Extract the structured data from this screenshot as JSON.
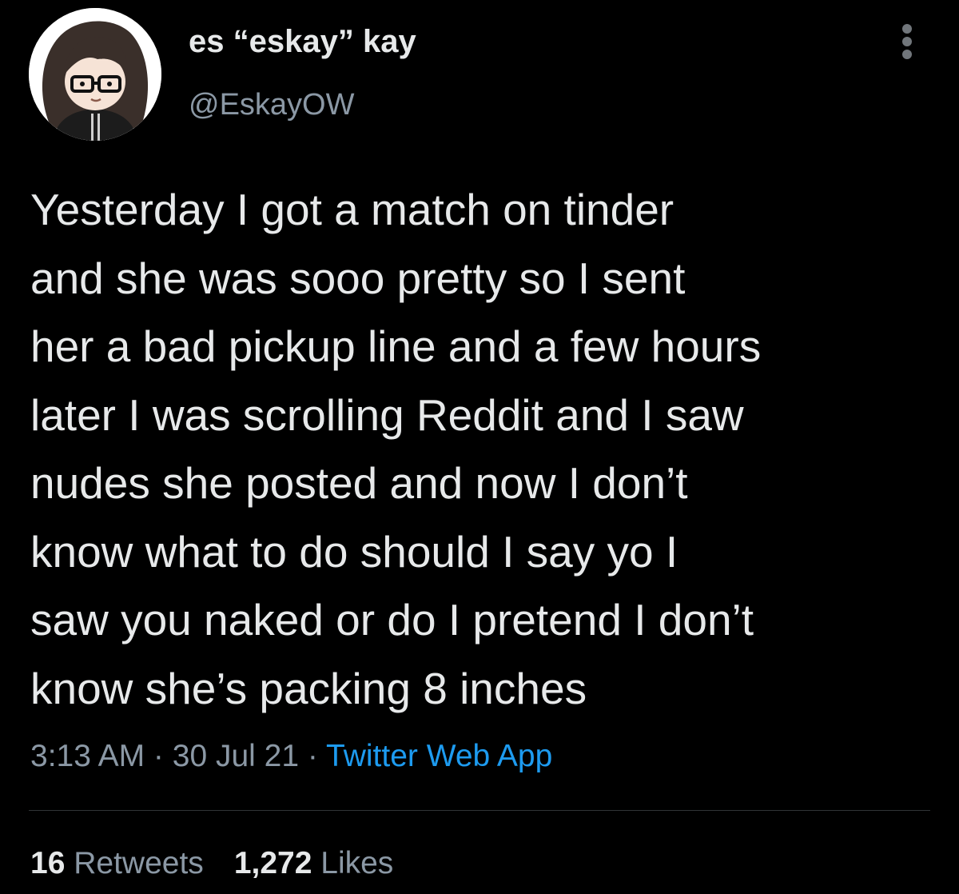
{
  "user": {
    "display_name": "es “eskay” kay",
    "handle": "@EskayOW",
    "avatar_icon": "cartoon-avatar-icon"
  },
  "more_icon": "more-dots-icon",
  "tweet": {
    "lines": [
      "Yesterday I got a match on tinder",
      "and she was sooo pretty so I sent",
      "her a bad pickup line and a few hours",
      "later I was scrolling Reddit and I saw",
      "nudes she posted and now I don’t",
      "know what to do should I say yo I",
      "saw you naked or do I pretend I don’t",
      "know she’s packing 8 inches"
    ]
  },
  "meta": {
    "time": "3:13 AM",
    "separator": " · ",
    "date": "30 Jul 21",
    "source": "Twitter Web App"
  },
  "stats": {
    "retweets_count": "16",
    "retweets_label": "Retweets",
    "likes_count": "1,272",
    "likes_label": "Likes"
  },
  "colors": {
    "background": "#000000",
    "text": "#e7e9ea",
    "secondary": "#8b98a5",
    "link": "#1d9bf0",
    "divider": "#2f3336"
  }
}
